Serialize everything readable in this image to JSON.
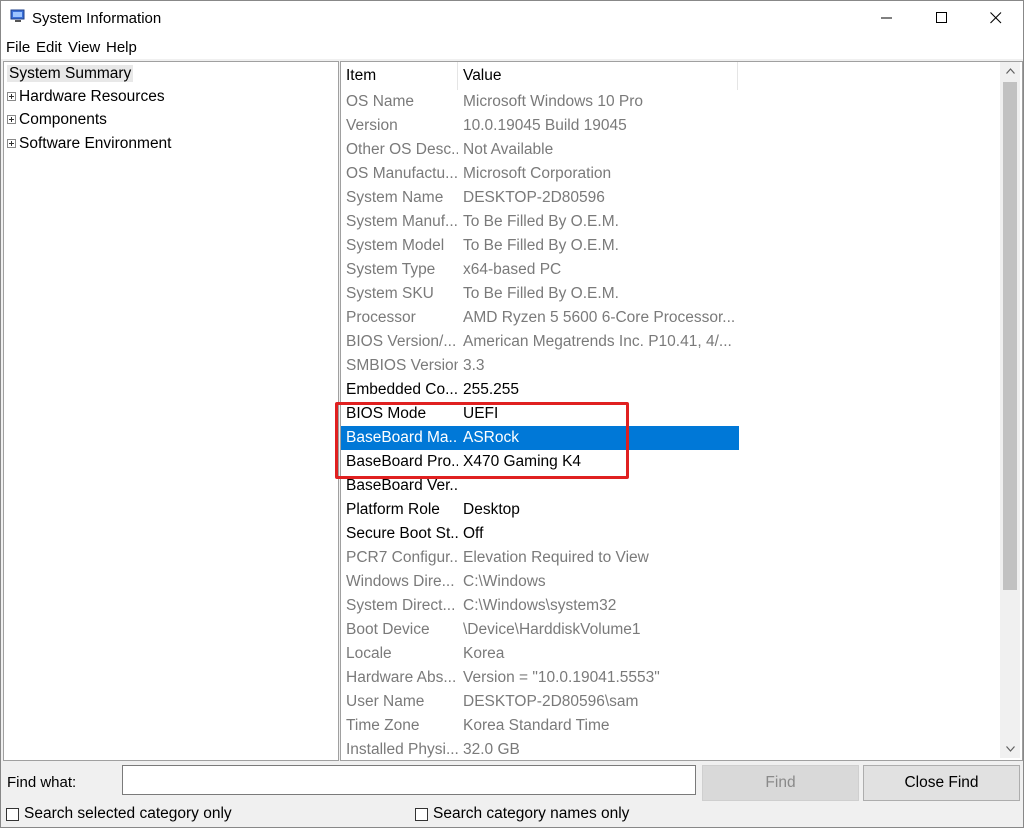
{
  "window": {
    "title": "System Information"
  },
  "menu": [
    "File",
    "Edit",
    "View",
    "Help"
  ],
  "tree": [
    {
      "label": "System Summary",
      "expandable": false,
      "selected": true
    },
    {
      "label": "Hardware Resources",
      "expandable": true
    },
    {
      "label": "Components",
      "expandable": true
    },
    {
      "label": "Software Environment",
      "expandable": true
    }
  ],
  "table": {
    "headers": [
      "Item",
      "Value"
    ],
    "rows": [
      {
        "item": "OS Name",
        "value": "Microsoft Windows 10 Pro",
        "state": "faded"
      },
      {
        "item": "Version",
        "value": "10.0.19045 Build 19045",
        "state": "faded"
      },
      {
        "item": "Other OS Desc...",
        "value": "Not Available",
        "state": "faded"
      },
      {
        "item": "OS Manufactu...",
        "value": "Microsoft Corporation",
        "state": "faded"
      },
      {
        "item": "System Name",
        "value": "DESKTOP-2D80596",
        "state": "faded"
      },
      {
        "item": "System Manuf...",
        "value": "To Be Filled By O.E.M.",
        "state": "faded"
      },
      {
        "item": "System Model",
        "value": "To Be Filled By O.E.M.",
        "state": "faded"
      },
      {
        "item": "System Type",
        "value": "x64-based PC",
        "state": "faded"
      },
      {
        "item": "System SKU",
        "value": "To Be Filled By O.E.M.",
        "state": "faded"
      },
      {
        "item": "Processor",
        "value": "AMD Ryzen 5 5600 6-Core Processor...",
        "state": "faded"
      },
      {
        "item": "BIOS Version/...",
        "value": "American Megatrends Inc. P10.41, 4/...",
        "state": "faded"
      },
      {
        "item": "SMBIOS Version",
        "value": "3.3",
        "state": "faded"
      },
      {
        "item": "Embedded Co...",
        "value": "255.255",
        "state": "normal"
      },
      {
        "item": "BIOS Mode",
        "value": "UEFI",
        "state": "normal"
      },
      {
        "item": "BaseBoard Ma...",
        "value": "ASRock",
        "state": "selected"
      },
      {
        "item": "BaseBoard Pro...",
        "value": "X470 Gaming K4",
        "state": "normal"
      },
      {
        "item": "BaseBoard Ver...",
        "value": "",
        "state": "normal"
      },
      {
        "item": "Platform Role",
        "value": "Desktop",
        "state": "normal"
      },
      {
        "item": "Secure Boot St...",
        "value": "Off",
        "state": "normal"
      },
      {
        "item": "PCR7 Configur...",
        "value": "Elevation Required to View",
        "state": "faded"
      },
      {
        "item": "Windows Dire...",
        "value": "C:\\Windows",
        "state": "faded"
      },
      {
        "item": "System Direct...",
        "value": "C:\\Windows\\system32",
        "state": "faded"
      },
      {
        "item": "Boot Device",
        "value": "\\Device\\HarddiskVolume1",
        "state": "faded"
      },
      {
        "item": "Locale",
        "value": "Korea",
        "state": "faded"
      },
      {
        "item": "Hardware Abs...",
        "value": "Version = \"10.0.19041.5553\"",
        "state": "faded"
      },
      {
        "item": "User Name",
        "value": "DESKTOP-2D80596\\sam",
        "state": "faded"
      },
      {
        "item": "Time Zone",
        "value": "Korea Standard Time",
        "state": "faded"
      },
      {
        "item": "Installed Physi...",
        "value": "32.0 GB",
        "state": "faded"
      }
    ]
  },
  "find": {
    "label": "Find what:",
    "value": "",
    "find_button": "Find",
    "close_button": "Close Find",
    "option1": "Search selected category only",
    "option2": "Search category names only"
  },
  "colors": {
    "selection": "#0078d7",
    "annotation_box": "#e02020"
  },
  "icons": [
    "system-info-icon",
    "minimize-icon",
    "maximize-icon",
    "close-icon",
    "scroll-up-icon",
    "scroll-down-icon",
    "expand-icon"
  ]
}
